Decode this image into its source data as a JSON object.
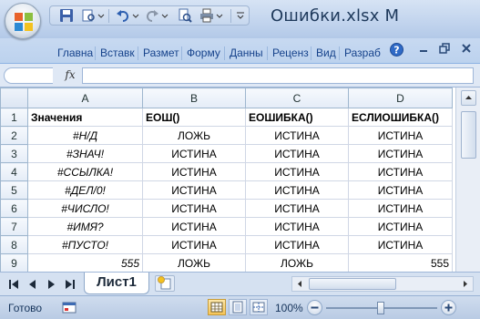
{
  "window": {
    "title": "Ошибки.xlsx",
    "title_truncated_suffix": "M"
  },
  "ribbon": {
    "tabs": [
      {
        "label": "Главна"
      },
      {
        "label": "Вставк"
      },
      {
        "label": "Размет"
      },
      {
        "label": "Форму"
      },
      {
        "label": "Данны"
      },
      {
        "label": "Реценз"
      },
      {
        "label": "Вид"
      },
      {
        "label": "Разраб"
      }
    ]
  },
  "formula_bar": {
    "name_box": "",
    "fx_label": "fx",
    "formula": ""
  },
  "sheet": {
    "columns": [
      "A",
      "B",
      "C",
      "D"
    ],
    "rows": [
      {
        "num": "1",
        "cells": [
          "Значения",
          "ЕОШ()",
          "ЕОШИБКА()",
          "ЕСЛИОШИБКА()"
        ]
      },
      {
        "num": "2",
        "cells": [
          "#Н/Д",
          "ЛОЖЬ",
          "ИСТИНА",
          "ИСТИНА"
        ]
      },
      {
        "num": "3",
        "cells": [
          "#ЗНАЧ!",
          "ИСТИНА",
          "ИСТИНА",
          "ИСТИНА"
        ]
      },
      {
        "num": "4",
        "cells": [
          "#ССЫЛКА!",
          "ИСТИНА",
          "ИСТИНА",
          "ИСТИНА"
        ]
      },
      {
        "num": "5",
        "cells": [
          "#ДЕЛ/0!",
          "ИСТИНА",
          "ИСТИНА",
          "ИСТИНА"
        ]
      },
      {
        "num": "6",
        "cells": [
          "#ЧИСЛО!",
          "ИСТИНА",
          "ИСТИНА",
          "ИСТИНА"
        ]
      },
      {
        "num": "7",
        "cells": [
          "#ИМЯ?",
          "ИСТИНА",
          "ИСТИНА",
          "ИСТИНА"
        ]
      },
      {
        "num": "8",
        "cells": [
          "#ПУСТО!",
          "ИСТИНА",
          "ИСТИНА",
          "ИСТИНА"
        ]
      },
      {
        "num": "9",
        "cells": [
          "555",
          "ЛОЖЬ",
          "ЛОЖЬ",
          "555"
        ]
      }
    ]
  },
  "sheet_tabs": {
    "active": "Лист1"
  },
  "status": {
    "ready": "Готово",
    "zoom": "100%"
  },
  "colors": {
    "accent": "#15428b",
    "title": "#1e395b",
    "grid_line": "#d0d7e5",
    "chrome": "#bcd0ea"
  }
}
